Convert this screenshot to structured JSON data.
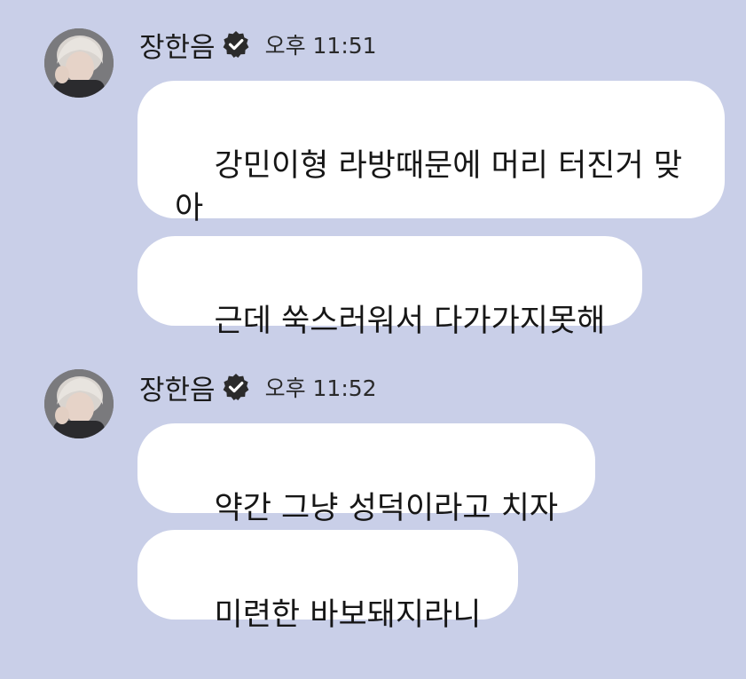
{
  "colors": {
    "background": "#c9cfe8",
    "bubble": "#ffffff",
    "verified_badge": "#2b2b2b"
  },
  "groups": [
    {
      "sender": "장한음",
      "verified_icon": "verified-badge-icon",
      "time": "오후 11:51",
      "messages": [
        "강민이형 라방때문에 머리 터진거 맞아",
        "근데 쑥스러워서 다가가지못해"
      ]
    },
    {
      "sender": "장한음",
      "verified_icon": "verified-badge-icon",
      "time": "오후 11:52",
      "messages": [
        "약간 그냥 성덕이라고 치자",
        "미련한 바보돼지라니"
      ]
    }
  ]
}
